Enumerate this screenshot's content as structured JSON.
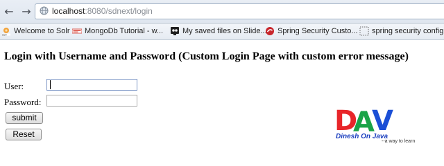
{
  "browser": {
    "url_host": "localhost",
    "url_rest": ":8080/sdnext/login",
    "bookmarks": [
      {
        "label": "Welcome to Solr",
        "icon": "solr-icon"
      },
      {
        "label": "MongoDb Tutorial - w...",
        "icon": "mongodb-icon"
      },
      {
        "label": "My saved files on Slide...",
        "icon": "slideshare-icon"
      },
      {
        "label": "Spring Security Custo...",
        "icon": "red-circle-icon"
      },
      {
        "label": "spring security config",
        "icon": "dotted-square-icon"
      }
    ]
  },
  "page": {
    "heading": "Login with Username and Password (Custom Login Page with custom error message)",
    "user_label": "User:",
    "password_label": "Password:",
    "submit_label": "submit",
    "reset_label": "Reset"
  },
  "logo": {
    "letters": "DAV",
    "name": "Dinesh On Java",
    "tagline": "--a way to learn",
    "colors": {
      "d": "#e8262a",
      "a": "#19a347",
      "v": "#1b4fd6"
    }
  }
}
